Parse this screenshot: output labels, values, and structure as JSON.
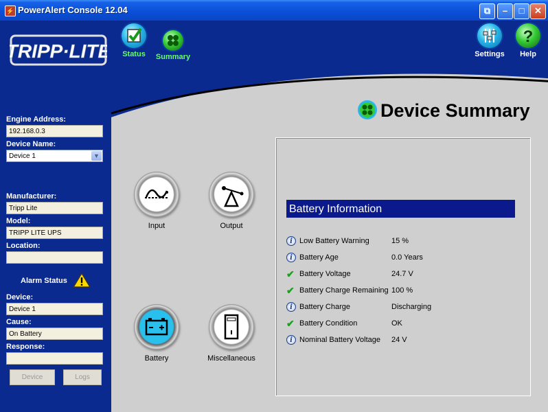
{
  "window": {
    "title": "PowerAlert Console 12.04"
  },
  "title_icons": [
    "restore-icon",
    "minimize-icon",
    "maximize-icon",
    "close-icon"
  ],
  "logo_text": "TRIPP·LITE",
  "nav": {
    "status": "Status",
    "summary": "Summary",
    "settings": "Settings",
    "help": "Help"
  },
  "sidebar": {
    "engine_address_label": "Engine Address:",
    "engine_address": "192.168.0.3",
    "device_name_label": "Device Name:",
    "device_name": "Device 1",
    "manufacturer_label": "Manufacturer:",
    "manufacturer": "Tripp Lite",
    "model_label": "Model:",
    "model": "TRIPP LITE UPS",
    "location_label": "Location:",
    "location": "",
    "alarm_status_label": "Alarm Status",
    "device_label": "Device:",
    "device": "Device 1",
    "cause_label": "Cause:",
    "cause": "On Battery",
    "response_label": "Response:",
    "response": "",
    "device_button": "Device",
    "logs_button": "Logs"
  },
  "page_title": "Device Summary",
  "devices": {
    "input": "Input",
    "output": "Output",
    "battery": "Battery",
    "misc": "Miscellaneous"
  },
  "battery_info": {
    "title": "Battery Information",
    "rows": [
      {
        "icon": "info-icon",
        "label": "Low Battery Warning",
        "value": "15 %"
      },
      {
        "icon": "info-icon",
        "label": "Battery Age",
        "value": "0.0 Years"
      },
      {
        "icon": "check-icon",
        "label": "Battery Voltage",
        "value": "24.7 V"
      },
      {
        "icon": "check-icon",
        "label": "Battery Charge Remaining",
        "value": "100 %"
      },
      {
        "icon": "info-icon",
        "label": "Battery Charge",
        "value": "Discharging"
      },
      {
        "icon": "check-icon",
        "label": "Battery Condition",
        "value": "OK"
      },
      {
        "icon": "info-icon",
        "label": "Nominal Battery Voltage",
        "value": "24 V"
      }
    ]
  }
}
